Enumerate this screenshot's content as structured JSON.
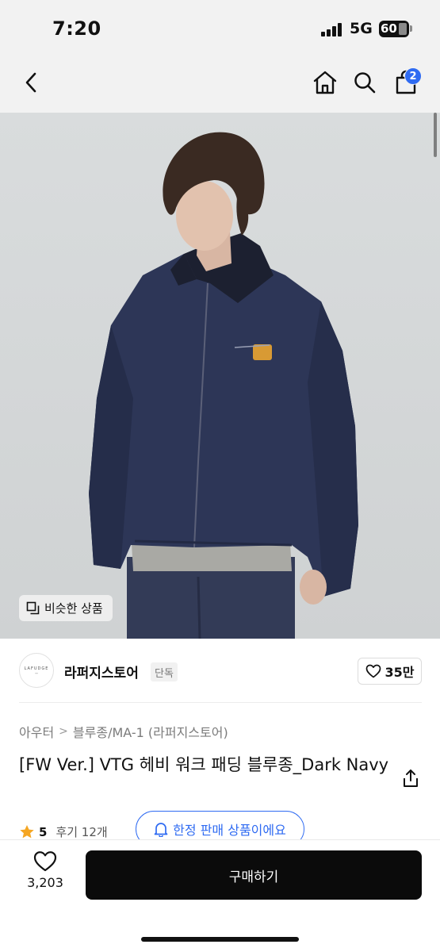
{
  "status_bar": {
    "time": "7:20",
    "network": "5G",
    "battery": "60"
  },
  "nav": {
    "back_icon": "chevron-left-icon",
    "home_icon": "home-icon",
    "search_icon": "search-icon",
    "cart_icon": "shopping-bag-icon",
    "cart_badge": "2",
    "badge_color": "#2f6bf2"
  },
  "image": {
    "similar_button_label": "비슷한 상품",
    "similar_button_icon": "copy-icon",
    "scroll_progress": 0.0
  },
  "seller": {
    "logo_text": "LAFUDGE",
    "name": "라퍼지스토어",
    "badge": "단독",
    "likes": "35만"
  },
  "breadcrumb": {
    "category": "아우터",
    "subcategory": "블루종/MA-1 (라퍼지스토어)"
  },
  "product": {
    "title": "[FW Ver.] VTG 헤비 워크 패딩 블루종_Dark Navy",
    "rating": "5",
    "review_label": "후기 12개",
    "limited_label": "한정 판매 상품이에요"
  },
  "bottom_bar": {
    "wish_count": "3,203",
    "buy_label": "구매하기"
  },
  "colors": {
    "accent": "#2f6bf2",
    "buy_button": "#0b0b0b",
    "star": "#f5a623",
    "header_bg": "#f2f2f2"
  }
}
